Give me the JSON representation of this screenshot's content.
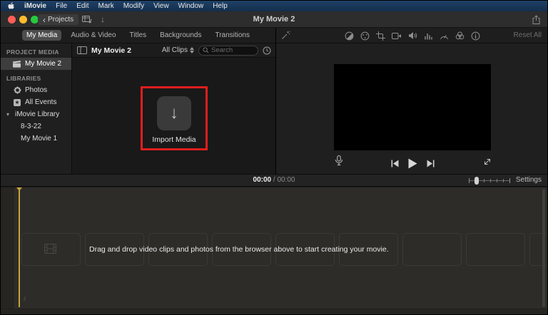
{
  "menu_bar": {
    "items": [
      "iMovie",
      "File",
      "Edit",
      "Mark",
      "Modify",
      "View",
      "Window",
      "Help"
    ]
  },
  "title_bar": {
    "back_label": "Projects",
    "title": "My Movie 2"
  },
  "media_tabs": {
    "selected": "My Media",
    "items": [
      "My Media",
      "Audio & Video",
      "Titles",
      "Backgrounds",
      "Transitions"
    ]
  },
  "viewer_toolbar": {
    "reset_label": "Reset All",
    "icon_names": [
      "enhance-wand",
      "color-balance",
      "color-palette",
      "crop",
      "stabilization-camera",
      "volume-speaker",
      "noise-reduction-bars",
      "speed-gauge",
      "clip-filter-circles",
      "info"
    ]
  },
  "sidebar": {
    "project_media_header": "PROJECT MEDIA",
    "libraries_header": "LIBRARIES",
    "items": [
      {
        "label": "My Movie 2",
        "selected": true
      },
      {
        "label": "Photos"
      },
      {
        "label": "All Events"
      },
      {
        "label": "iMovie Library",
        "expanded": true
      },
      {
        "label": "8-3-22"
      },
      {
        "label": "My Movie 1"
      }
    ]
  },
  "browser": {
    "title": "My Movie 2",
    "clips_filter": "All Clips",
    "search_placeholder": "Search",
    "import_label": "Import Media"
  },
  "timeline_toolbar": {
    "current_time": "00:00",
    "separator": "/",
    "total_time": "00:00",
    "settings_label": "Settings"
  },
  "timeline": {
    "empty_message": "Drag and drop video clips and photos from the browser above to start creating your movie.",
    "placeholder_count": 9
  },
  "icons": {
    "chevron_back": "‹",
    "import_arrow": "↓",
    "disclosure_down": "▾",
    "star": "★",
    "music_note": "♪"
  },
  "colors": {
    "menu_bar_blue": "#1c3d61",
    "annotation_red": "#e01d1d",
    "playhead_yellow": "#c7a23b",
    "traffic_red": "#ff5f57",
    "traffic_yellow": "#febc2e",
    "traffic_green": "#28c840",
    "selected_pill": "#4d4d4d"
  }
}
